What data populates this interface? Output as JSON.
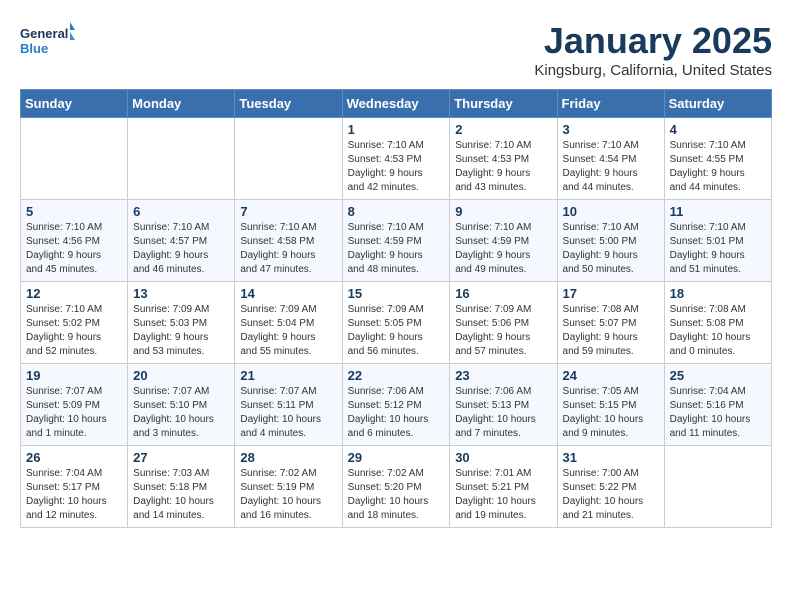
{
  "logo": {
    "line1": "General",
    "line2": "Blue"
  },
  "title": "January 2025",
  "location": "Kingsburg, California, United States",
  "days_of_week": [
    "Sunday",
    "Monday",
    "Tuesday",
    "Wednesday",
    "Thursday",
    "Friday",
    "Saturday"
  ],
  "weeks": [
    [
      {
        "day": "",
        "info": ""
      },
      {
        "day": "",
        "info": ""
      },
      {
        "day": "",
        "info": ""
      },
      {
        "day": "1",
        "info": "Sunrise: 7:10 AM\nSunset: 4:53 PM\nDaylight: 9 hours\nand 42 minutes."
      },
      {
        "day": "2",
        "info": "Sunrise: 7:10 AM\nSunset: 4:53 PM\nDaylight: 9 hours\nand 43 minutes."
      },
      {
        "day": "3",
        "info": "Sunrise: 7:10 AM\nSunset: 4:54 PM\nDaylight: 9 hours\nand 44 minutes."
      },
      {
        "day": "4",
        "info": "Sunrise: 7:10 AM\nSunset: 4:55 PM\nDaylight: 9 hours\nand 44 minutes."
      }
    ],
    [
      {
        "day": "5",
        "info": "Sunrise: 7:10 AM\nSunset: 4:56 PM\nDaylight: 9 hours\nand 45 minutes."
      },
      {
        "day": "6",
        "info": "Sunrise: 7:10 AM\nSunset: 4:57 PM\nDaylight: 9 hours\nand 46 minutes."
      },
      {
        "day": "7",
        "info": "Sunrise: 7:10 AM\nSunset: 4:58 PM\nDaylight: 9 hours\nand 47 minutes."
      },
      {
        "day": "8",
        "info": "Sunrise: 7:10 AM\nSunset: 4:59 PM\nDaylight: 9 hours\nand 48 minutes."
      },
      {
        "day": "9",
        "info": "Sunrise: 7:10 AM\nSunset: 4:59 PM\nDaylight: 9 hours\nand 49 minutes."
      },
      {
        "day": "10",
        "info": "Sunrise: 7:10 AM\nSunset: 5:00 PM\nDaylight: 9 hours\nand 50 minutes."
      },
      {
        "day": "11",
        "info": "Sunrise: 7:10 AM\nSunset: 5:01 PM\nDaylight: 9 hours\nand 51 minutes."
      }
    ],
    [
      {
        "day": "12",
        "info": "Sunrise: 7:10 AM\nSunset: 5:02 PM\nDaylight: 9 hours\nand 52 minutes."
      },
      {
        "day": "13",
        "info": "Sunrise: 7:09 AM\nSunset: 5:03 PM\nDaylight: 9 hours\nand 53 minutes."
      },
      {
        "day": "14",
        "info": "Sunrise: 7:09 AM\nSunset: 5:04 PM\nDaylight: 9 hours\nand 55 minutes."
      },
      {
        "day": "15",
        "info": "Sunrise: 7:09 AM\nSunset: 5:05 PM\nDaylight: 9 hours\nand 56 minutes."
      },
      {
        "day": "16",
        "info": "Sunrise: 7:09 AM\nSunset: 5:06 PM\nDaylight: 9 hours\nand 57 minutes."
      },
      {
        "day": "17",
        "info": "Sunrise: 7:08 AM\nSunset: 5:07 PM\nDaylight: 9 hours\nand 59 minutes."
      },
      {
        "day": "18",
        "info": "Sunrise: 7:08 AM\nSunset: 5:08 PM\nDaylight: 10 hours\nand 0 minutes."
      }
    ],
    [
      {
        "day": "19",
        "info": "Sunrise: 7:07 AM\nSunset: 5:09 PM\nDaylight: 10 hours\nand 1 minute."
      },
      {
        "day": "20",
        "info": "Sunrise: 7:07 AM\nSunset: 5:10 PM\nDaylight: 10 hours\nand 3 minutes."
      },
      {
        "day": "21",
        "info": "Sunrise: 7:07 AM\nSunset: 5:11 PM\nDaylight: 10 hours\nand 4 minutes."
      },
      {
        "day": "22",
        "info": "Sunrise: 7:06 AM\nSunset: 5:12 PM\nDaylight: 10 hours\nand 6 minutes."
      },
      {
        "day": "23",
        "info": "Sunrise: 7:06 AM\nSunset: 5:13 PM\nDaylight: 10 hours\nand 7 minutes."
      },
      {
        "day": "24",
        "info": "Sunrise: 7:05 AM\nSunset: 5:15 PM\nDaylight: 10 hours\nand 9 minutes."
      },
      {
        "day": "25",
        "info": "Sunrise: 7:04 AM\nSunset: 5:16 PM\nDaylight: 10 hours\nand 11 minutes."
      }
    ],
    [
      {
        "day": "26",
        "info": "Sunrise: 7:04 AM\nSunset: 5:17 PM\nDaylight: 10 hours\nand 12 minutes."
      },
      {
        "day": "27",
        "info": "Sunrise: 7:03 AM\nSunset: 5:18 PM\nDaylight: 10 hours\nand 14 minutes."
      },
      {
        "day": "28",
        "info": "Sunrise: 7:02 AM\nSunset: 5:19 PM\nDaylight: 10 hours\nand 16 minutes."
      },
      {
        "day": "29",
        "info": "Sunrise: 7:02 AM\nSunset: 5:20 PM\nDaylight: 10 hours\nand 18 minutes."
      },
      {
        "day": "30",
        "info": "Sunrise: 7:01 AM\nSunset: 5:21 PM\nDaylight: 10 hours\nand 19 minutes."
      },
      {
        "day": "31",
        "info": "Sunrise: 7:00 AM\nSunset: 5:22 PM\nDaylight: 10 hours\nand 21 minutes."
      },
      {
        "day": "",
        "info": ""
      }
    ]
  ]
}
